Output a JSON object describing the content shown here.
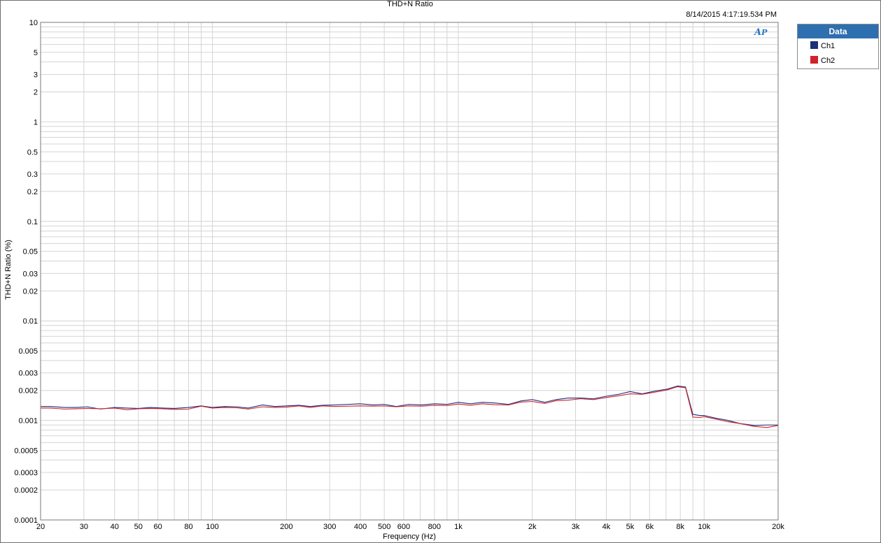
{
  "chart": {
    "title": "THD+N Ratio",
    "timestamp": "8/14/2015 4:17:19.534 PM",
    "logo_text": "AP"
  },
  "legend": {
    "title": "Data",
    "items": [
      {
        "label": "Ch1",
        "color": "#1b2f7a"
      },
      {
        "label": "Ch2",
        "color": "#d0232b"
      }
    ]
  },
  "colors": {
    "grid": "#d4d4d4",
    "plot_border": "#7a7a7a",
    "legend_header": "#2e6faf"
  },
  "chart_data": {
    "type": "line",
    "title": "THD+N Ratio",
    "xlabel": "Frequency (Hz)",
    "ylabel": "THD+N Ratio (%)",
    "xscale": "log",
    "yscale": "log",
    "xlim": [
      20,
      20000
    ],
    "ylim": [
      0.0001,
      10
    ],
    "grid": true,
    "legend_position": "right-outside",
    "x_ticks": [
      {
        "value": 20,
        "label": "20"
      },
      {
        "value": 30,
        "label": "30"
      },
      {
        "value": 40,
        "label": "40"
      },
      {
        "value": 50,
        "label": "50"
      },
      {
        "value": 60,
        "label": "60"
      },
      {
        "value": 80,
        "label": "80"
      },
      {
        "value": 100,
        "label": "100"
      },
      {
        "value": 200,
        "label": "200"
      },
      {
        "value": 300,
        "label": "300"
      },
      {
        "value": 400,
        "label": "400"
      },
      {
        "value": 500,
        "label": "500"
      },
      {
        "value": 600,
        "label": "600"
      },
      {
        "value": 800,
        "label": "800"
      },
      {
        "value": 1000,
        "label": "1k"
      },
      {
        "value": 2000,
        "label": "2k"
      },
      {
        "value": 3000,
        "label": "3k"
      },
      {
        "value": 4000,
        "label": "4k"
      },
      {
        "value": 5000,
        "label": "5k"
      },
      {
        "value": 6000,
        "label": "6k"
      },
      {
        "value": 8000,
        "label": "8k"
      },
      {
        "value": 10000,
        "label": "10k"
      },
      {
        "value": 20000,
        "label": "20k"
      }
    ],
    "y_ticks": [
      {
        "value": 10,
        "label": "10"
      },
      {
        "value": 5,
        "label": "5"
      },
      {
        "value": 3,
        "label": "3"
      },
      {
        "value": 2,
        "label": "2"
      },
      {
        "value": 1,
        "label": "1"
      },
      {
        "value": 0.5,
        "label": "0.5"
      },
      {
        "value": 0.3,
        "label": "0.3"
      },
      {
        "value": 0.2,
        "label": "0.2"
      },
      {
        "value": 0.1,
        "label": "0.1"
      },
      {
        "value": 0.05,
        "label": "0.05"
      },
      {
        "value": 0.03,
        "label": "0.03"
      },
      {
        "value": 0.02,
        "label": "0.02"
      },
      {
        "value": 0.01,
        "label": "0.01"
      },
      {
        "value": 0.005,
        "label": "0.005"
      },
      {
        "value": 0.003,
        "label": "0.003"
      },
      {
        "value": 0.002,
        "label": "0.002"
      },
      {
        "value": 0.001,
        "label": "0.001"
      },
      {
        "value": 0.0005,
        "label": "0.0005"
      },
      {
        "value": 0.0003,
        "label": "0.0003"
      },
      {
        "value": 0.0002,
        "label": "0.0002"
      },
      {
        "value": 0.0001,
        "label": "0.0001"
      }
    ],
    "series": [
      {
        "name": "Ch1",
        "color": "#1b2f7a",
        "points": [
          [
            20,
            0.00138
          ],
          [
            22,
            0.00138
          ],
          [
            25,
            0.00135
          ],
          [
            28,
            0.00135
          ],
          [
            31,
            0.00137
          ],
          [
            35,
            0.0013
          ],
          [
            40,
            0.00135
          ],
          [
            45,
            0.00133
          ],
          [
            50,
            0.00132
          ],
          [
            56,
            0.00135
          ],
          [
            63,
            0.00133
          ],
          [
            70,
            0.00132
          ],
          [
            80,
            0.00135
          ],
          [
            90,
            0.0014
          ],
          [
            100,
            0.00135
          ],
          [
            112,
            0.00138
          ],
          [
            125,
            0.00137
          ],
          [
            140,
            0.00133
          ],
          [
            160,
            0.00143
          ],
          [
            180,
            0.00138
          ],
          [
            200,
            0.0014
          ],
          [
            225,
            0.00142
          ],
          [
            250,
            0.00138
          ],
          [
            280,
            0.00142
          ],
          [
            315,
            0.00143
          ],
          [
            355,
            0.00145
          ],
          [
            400,
            0.00147
          ],
          [
            450,
            0.00143
          ],
          [
            500,
            0.00145
          ],
          [
            560,
            0.00138
          ],
          [
            630,
            0.00145
          ],
          [
            710,
            0.00143
          ],
          [
            800,
            0.00147
          ],
          [
            900,
            0.00145
          ],
          [
            1000,
            0.00152
          ],
          [
            1120,
            0.00147
          ],
          [
            1250,
            0.00152
          ],
          [
            1400,
            0.0015
          ],
          [
            1600,
            0.00145
          ],
          [
            1800,
            0.00157
          ],
          [
            2000,
            0.00162
          ],
          [
            2250,
            0.00152
          ],
          [
            2500,
            0.00162
          ],
          [
            2800,
            0.00168
          ],
          [
            3150,
            0.00168
          ],
          [
            3550,
            0.00165
          ],
          [
            4000,
            0.00175
          ],
          [
            4500,
            0.00183
          ],
          [
            5000,
            0.00195
          ],
          [
            5600,
            0.00185
          ],
          [
            6300,
            0.00197
          ],
          [
            7100,
            0.00207
          ],
          [
            7800,
            0.00222
          ],
          [
            8400,
            0.00217
          ],
          [
            9000,
            0.00115
          ],
          [
            9600,
            0.00112
          ],
          [
            10000,
            0.00112
          ],
          [
            11200,
            0.00105
          ],
          [
            12500,
            0.001
          ],
          [
            14000,
            0.00093
          ],
          [
            16000,
            0.00089
          ],
          [
            18000,
            0.0009
          ],
          [
            20000,
            0.0009
          ]
        ]
      },
      {
        "name": "Ch2",
        "color": "#d0232b",
        "points": [
          [
            20,
            0.00133
          ],
          [
            22,
            0.00133
          ],
          [
            25,
            0.0013
          ],
          [
            28,
            0.00131
          ],
          [
            31,
            0.00132
          ],
          [
            35,
            0.00131
          ],
          [
            40,
            0.00133
          ],
          [
            45,
            0.00128
          ],
          [
            50,
            0.00131
          ],
          [
            56,
            0.00132
          ],
          [
            63,
            0.00131
          ],
          [
            70,
            0.00129
          ],
          [
            80,
            0.0013
          ],
          [
            90,
            0.00139
          ],
          [
            100,
            0.00133
          ],
          [
            112,
            0.00135
          ],
          [
            125,
            0.00134
          ],
          [
            140,
            0.0013
          ],
          [
            160,
            0.00137
          ],
          [
            180,
            0.00135
          ],
          [
            200,
            0.00136
          ],
          [
            225,
            0.0014
          ],
          [
            250,
            0.00135
          ],
          [
            280,
            0.0014
          ],
          [
            315,
            0.00138
          ],
          [
            355,
            0.00139
          ],
          [
            400,
            0.0014
          ],
          [
            450,
            0.00139
          ],
          [
            500,
            0.0014
          ],
          [
            560,
            0.00137
          ],
          [
            630,
            0.0014
          ],
          [
            710,
            0.00139
          ],
          [
            800,
            0.00142
          ],
          [
            900,
            0.00141
          ],
          [
            1000,
            0.00146
          ],
          [
            1120,
            0.00142
          ],
          [
            1250,
            0.00147
          ],
          [
            1400,
            0.00144
          ],
          [
            1600,
            0.00143
          ],
          [
            1800,
            0.00153
          ],
          [
            2000,
            0.00155
          ],
          [
            2250,
            0.00148
          ],
          [
            2500,
            0.00158
          ],
          [
            2800,
            0.0016
          ],
          [
            3150,
            0.00165
          ],
          [
            3550,
            0.00162
          ],
          [
            4000,
            0.0017
          ],
          [
            4500,
            0.00177
          ],
          [
            5000,
            0.00185
          ],
          [
            5600,
            0.00183
          ],
          [
            6300,
            0.00192
          ],
          [
            7100,
            0.00203
          ],
          [
            7800,
            0.00218
          ],
          [
            8400,
            0.00213
          ],
          [
            9000,
            0.00108
          ],
          [
            9600,
            0.00107
          ],
          [
            10000,
            0.00109
          ],
          [
            11200,
            0.00103
          ],
          [
            12500,
            0.00097
          ],
          [
            14000,
            0.00093
          ],
          [
            16000,
            0.00087
          ],
          [
            18000,
            0.00085
          ],
          [
            20000,
            0.00089
          ]
        ]
      }
    ]
  }
}
